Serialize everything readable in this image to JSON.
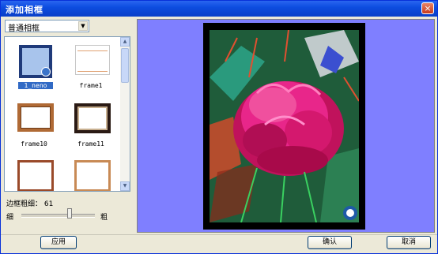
{
  "window": {
    "title": "添加相框",
    "close_glyph": "×"
  },
  "frame_type": {
    "selected": "普通相框",
    "arrow": "▼"
  },
  "frames": [
    {
      "label": "1_neno",
      "selected": true,
      "style": "blue"
    },
    {
      "label": "frame1",
      "selected": false,
      "style": "thin-orange"
    },
    {
      "label": "frame10",
      "selected": false,
      "style": "wood"
    },
    {
      "label": "frame11",
      "selected": false,
      "style": "dark"
    },
    {
      "label": "",
      "selected": false,
      "style": "rust"
    },
    {
      "label": "",
      "selected": false,
      "style": "copper"
    }
  ],
  "scrollbar": {
    "up": "▲",
    "down": "▼"
  },
  "thickness": {
    "label": "边框粗细： 61",
    "thin": "细",
    "thick": "粗",
    "value": 61
  },
  "buttons": {
    "apply": "应用",
    "ok": "确认",
    "cancel": "取消"
  },
  "colors": {
    "preview_bg": "#7f7fff",
    "titlebar": "#0d4de0",
    "selection": "#316ac5"
  }
}
